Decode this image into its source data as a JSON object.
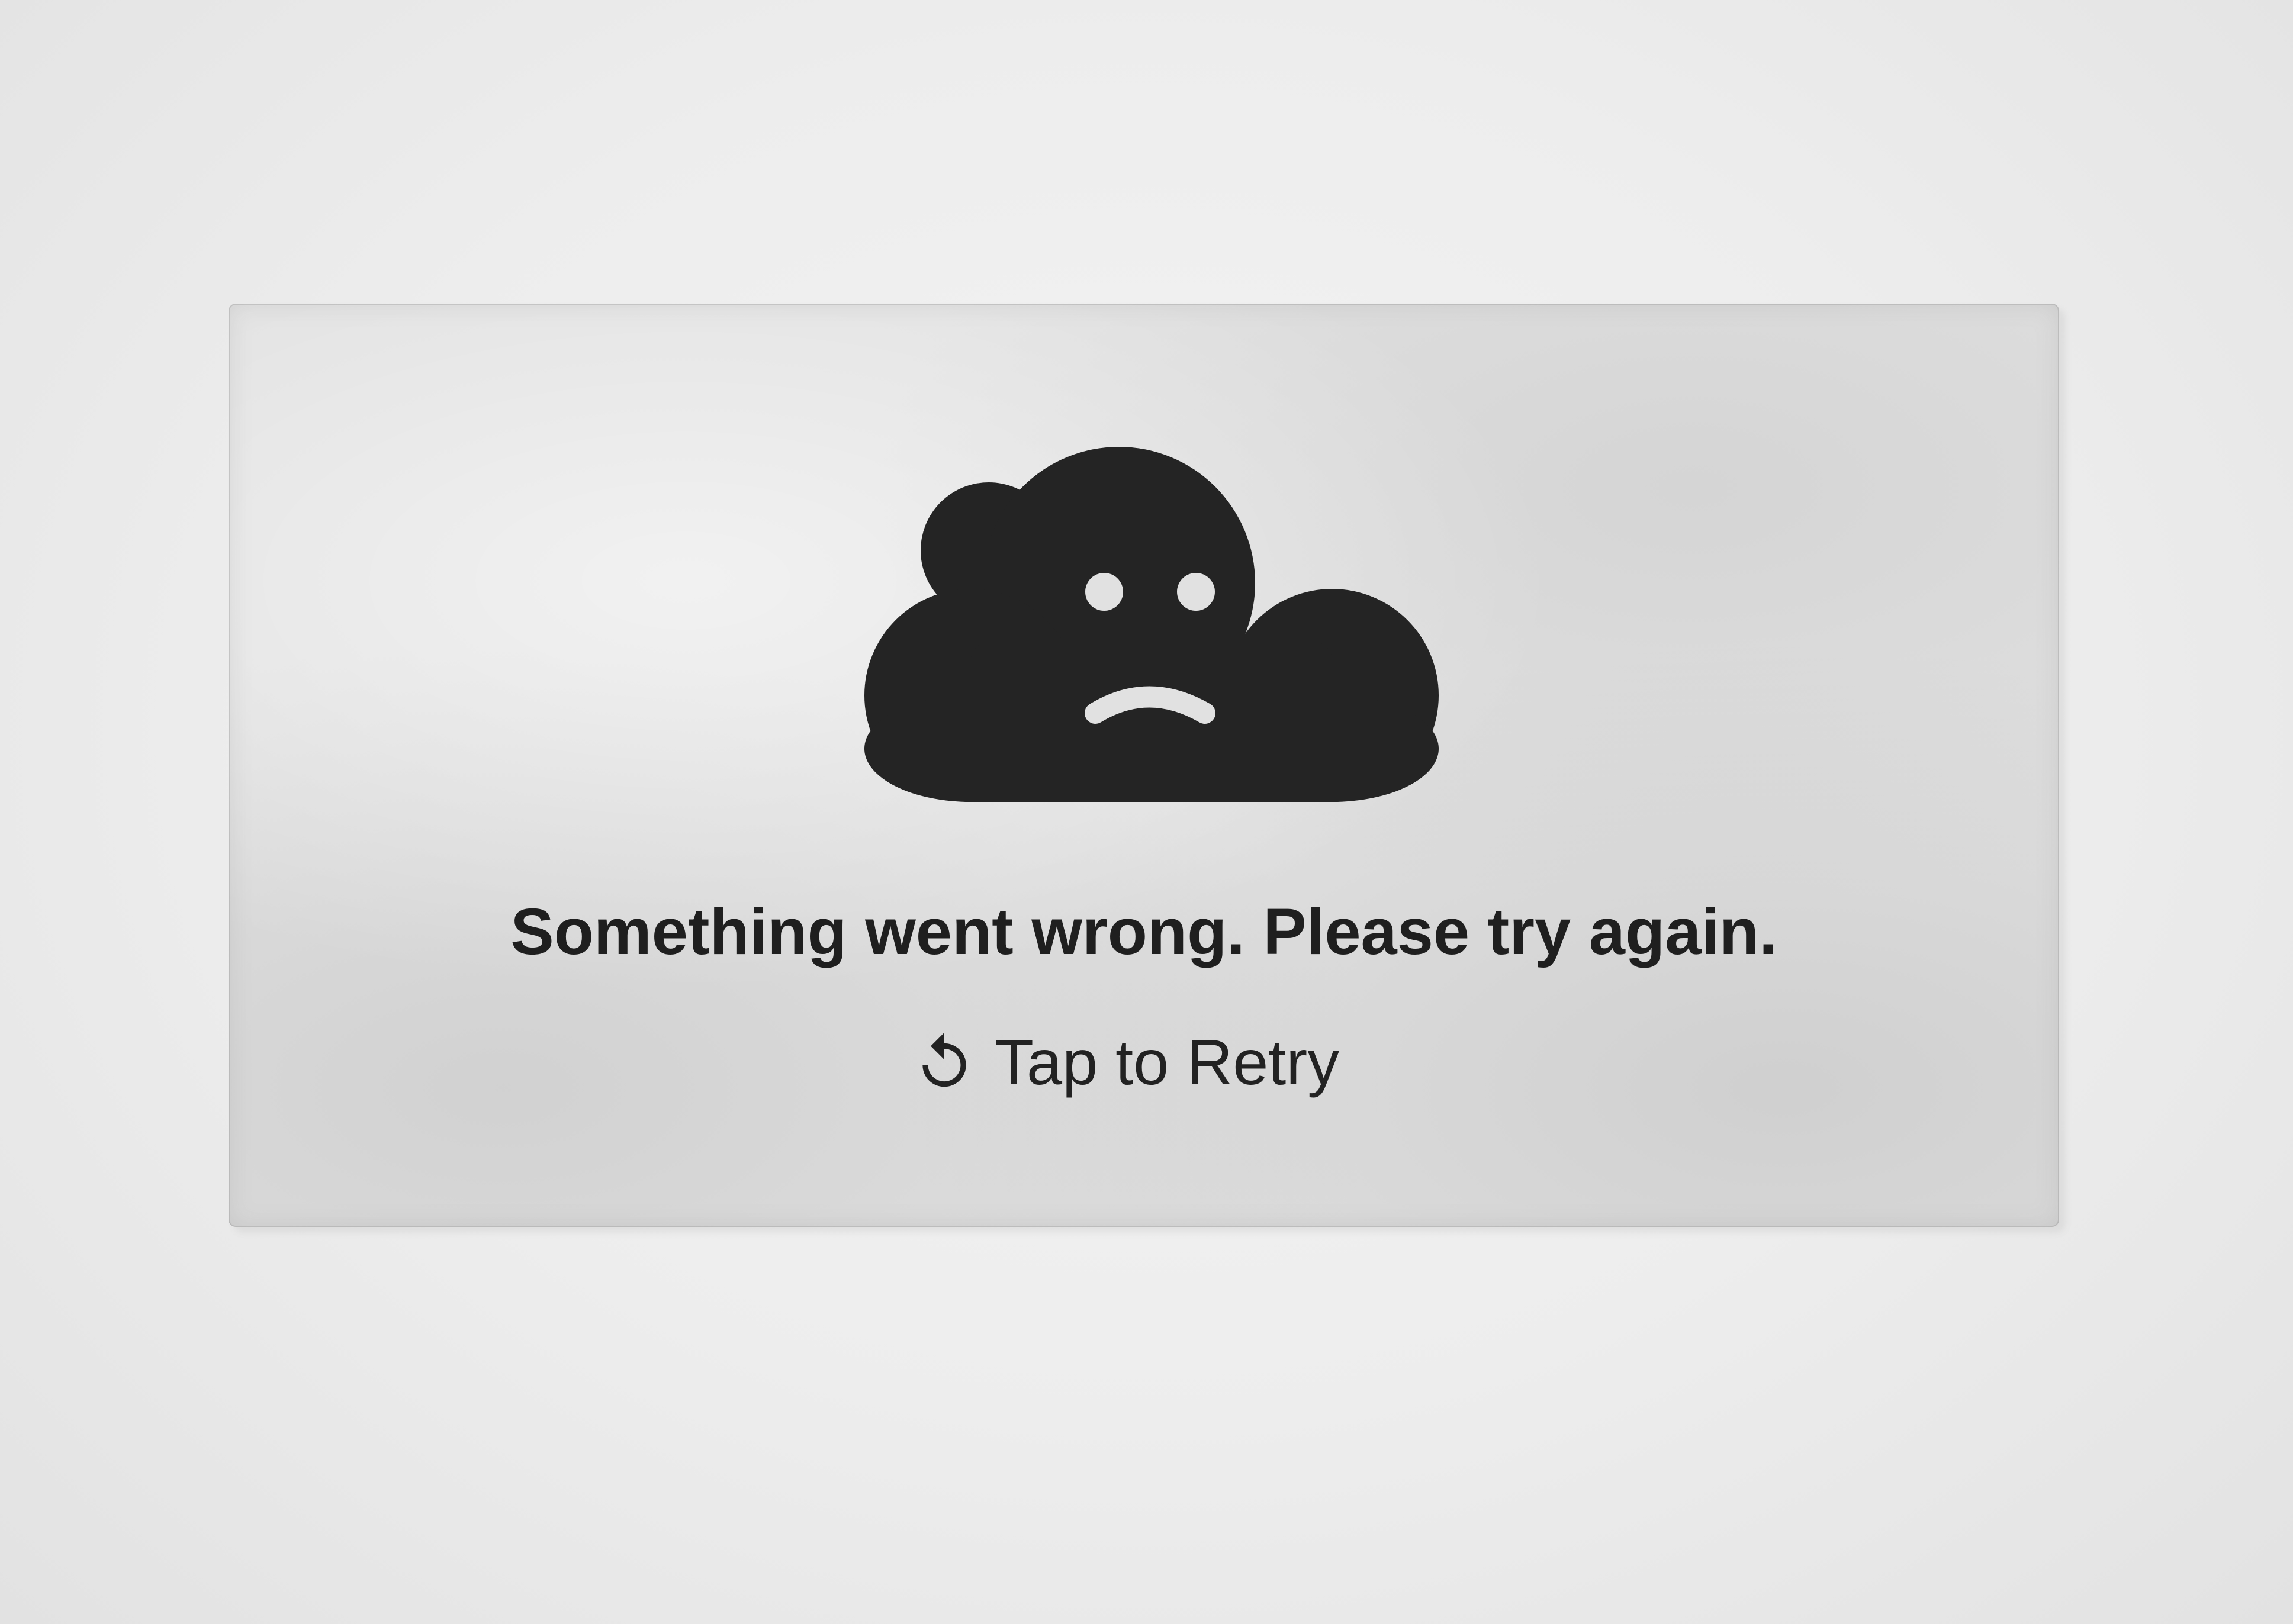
{
  "error_panel": {
    "icon": "sad-cloud-icon",
    "message": "Something went wrong. Please try again.",
    "retry": {
      "icon": "refresh-icon",
      "label": "Tap to Retry"
    }
  },
  "colors": {
    "background": "#ededed",
    "card": "#e1e1e1",
    "icon": "#242424",
    "text": "#1f1f1f"
  }
}
